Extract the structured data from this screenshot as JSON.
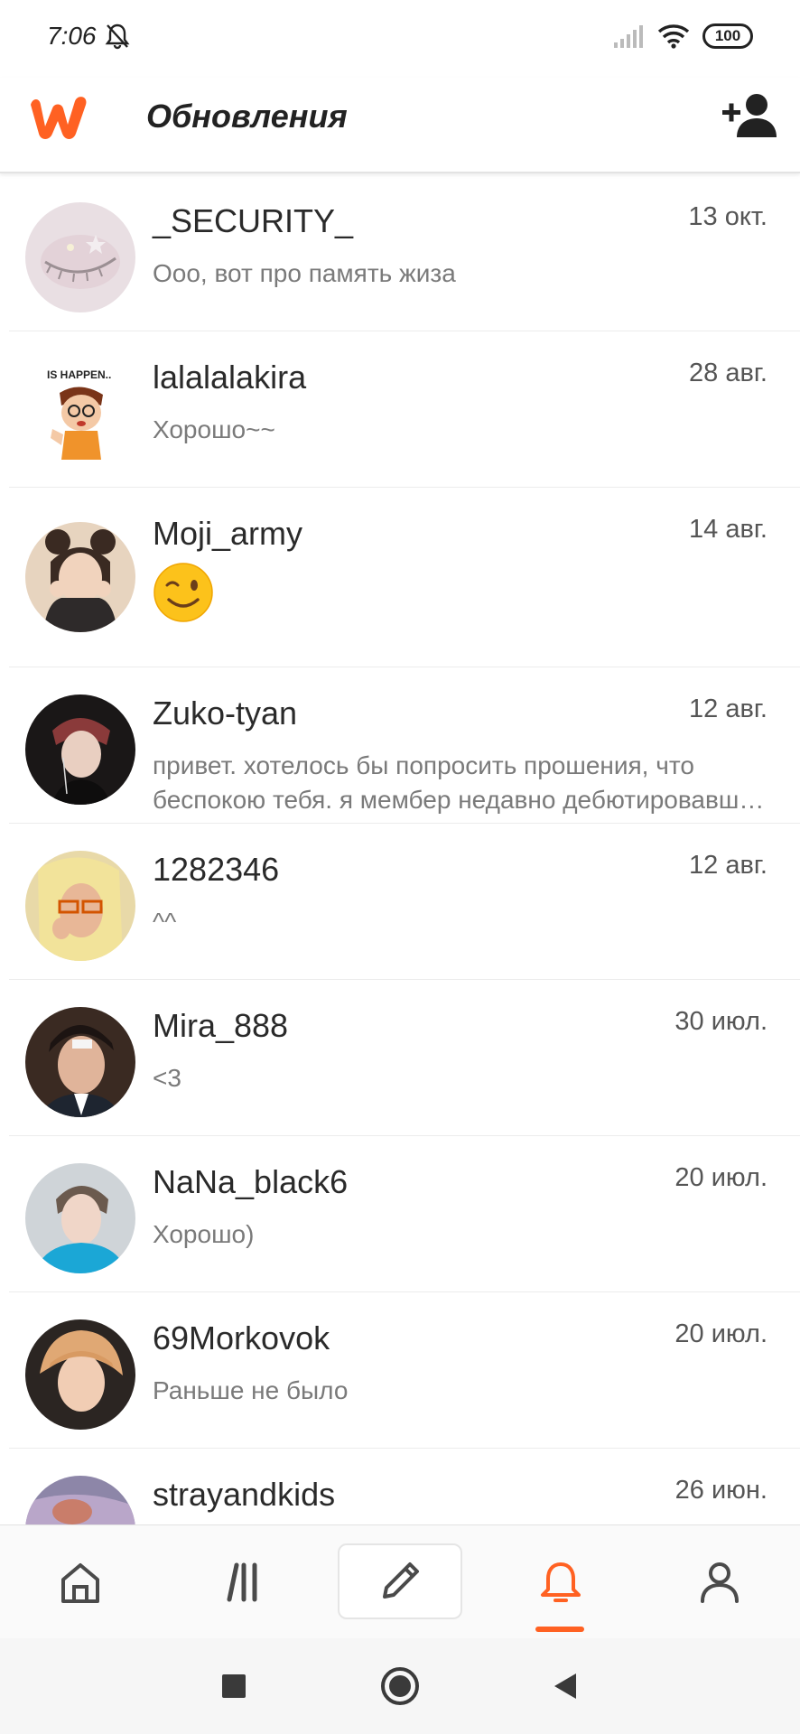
{
  "status_bar": {
    "time": "7:06",
    "battery": "100"
  },
  "header": {
    "title": "Обновления",
    "brand_color": "#ff6122"
  },
  "icons": {
    "logo": "wattpad-logo-icon",
    "add_user": "add-person-icon",
    "muted": "bell-muted-icon"
  },
  "messages": [
    {
      "name": "_SECURITY_",
      "date": "13 окт.",
      "preview": "Ооо, вот про память жиза"
    },
    {
      "name": "lalalalakira",
      "date": "28 авг.",
      "preview": "Хорошо~~"
    },
    {
      "name": "Moji_army",
      "date": "14 авг.",
      "preview": "",
      "emoji": "winking-face"
    },
    {
      "name": "Zuko-tyan",
      "date": "12 авг.",
      "preview": "привет. хотелось бы попросить прошения, что беспокою тебя. я мембер недавно дебютировавшей группы"
    },
    {
      "name": "1282346",
      "date": "12 авг.",
      "preview": "^^"
    },
    {
      "name": "Mira_888",
      "date": "30 июл.",
      "preview": "<3"
    },
    {
      "name": "NaNa_black6",
      "date": "20 июл.",
      "preview": "Хорошо)"
    },
    {
      "name": "69Morkovok",
      "date": "20 июл.",
      "preview": "Раньше не было"
    },
    {
      "name": "strayandkids",
      "date": "26 июн.",
      "preview": ""
    }
  ],
  "bottom_nav": [
    {
      "name": "home-icon",
      "active": false
    },
    {
      "name": "library-icon",
      "active": false
    },
    {
      "name": "write-icon",
      "active": false
    },
    {
      "name": "notifications-icon",
      "active": true
    },
    {
      "name": "profile-icon",
      "active": false
    }
  ],
  "system_nav": [
    "recents-icon",
    "home-circle-icon",
    "back-icon"
  ]
}
